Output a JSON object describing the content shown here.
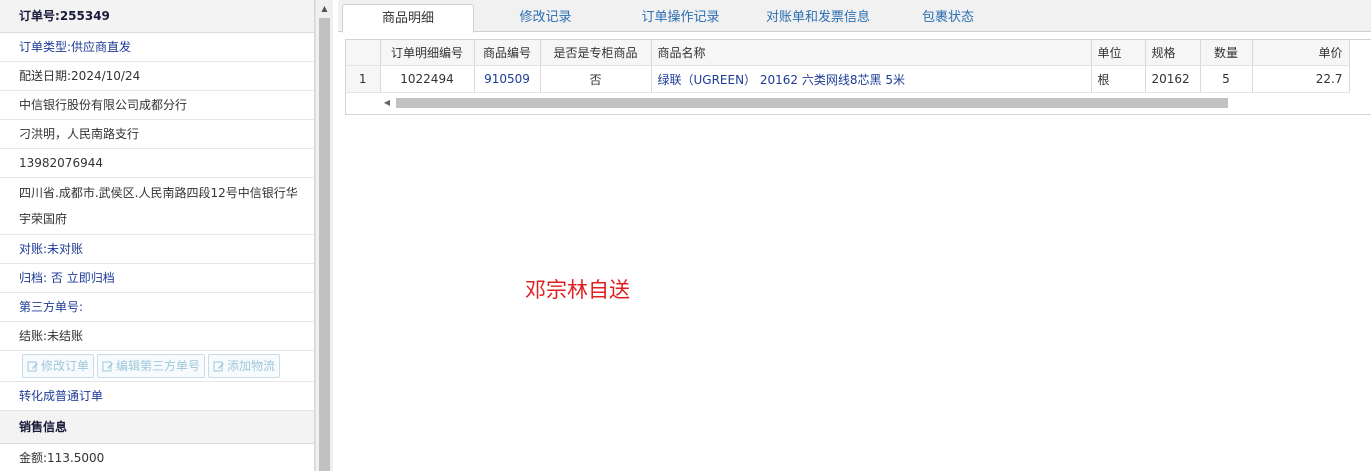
{
  "order": {
    "order_no_label": "订单号:",
    "order_no": "255349",
    "order_type_label": "订单类型:",
    "order_type": "供应商直发",
    "delivery_date_label": "配送日期:",
    "delivery_date": "2024/10/24",
    "company": "中信银行股份有限公司成都分行",
    "contact": "刁洪明，人民南路支行",
    "phone": "13982076944",
    "address": "四川省.成都市.武侯区.人民南路四段12号中信银行华宇荣国府",
    "reconcile_label": "对账:",
    "reconcile_value": "未对账",
    "archive_label": "归档:",
    "archive_value": "否",
    "archive_link": "立即归档",
    "third_party_label": "第三方单号:",
    "settle_label": "结账:",
    "settle_value": "未结账",
    "buttons": [
      "修改订单",
      "编辑第三方单号",
      "添加物流"
    ],
    "convert_link": "转化成普通订单"
  },
  "sales": {
    "header": "销售信息",
    "amount_label": "金额:",
    "amount": "113.5000"
  },
  "tabs": [
    "商品明细",
    "修改记录",
    "订单操作记录",
    "对账单和发票信息",
    "包裹状态"
  ],
  "grid": {
    "columns": [
      "",
      "订单明细编号",
      "商品编号",
      "是否是专柜商品",
      "商品名称",
      "单位",
      "规格",
      "数量",
      "单价"
    ],
    "rows": [
      {
        "row_num": "1",
        "detail_id": "1022494",
        "product_id": "910509",
        "is_counter": "否",
        "name": "绿联（UGREEN） 20162 六类网线8芯黑 5米",
        "unit": "根",
        "spec": "20162",
        "qty": "5",
        "price": "22.7"
      }
    ]
  },
  "note": "邓宗林自送",
  "colors": {
    "link": "#1e3c96",
    "tab_text": "#2a6fb2",
    "note": "#e02020",
    "disabled_button": "#9fc7db"
  }
}
